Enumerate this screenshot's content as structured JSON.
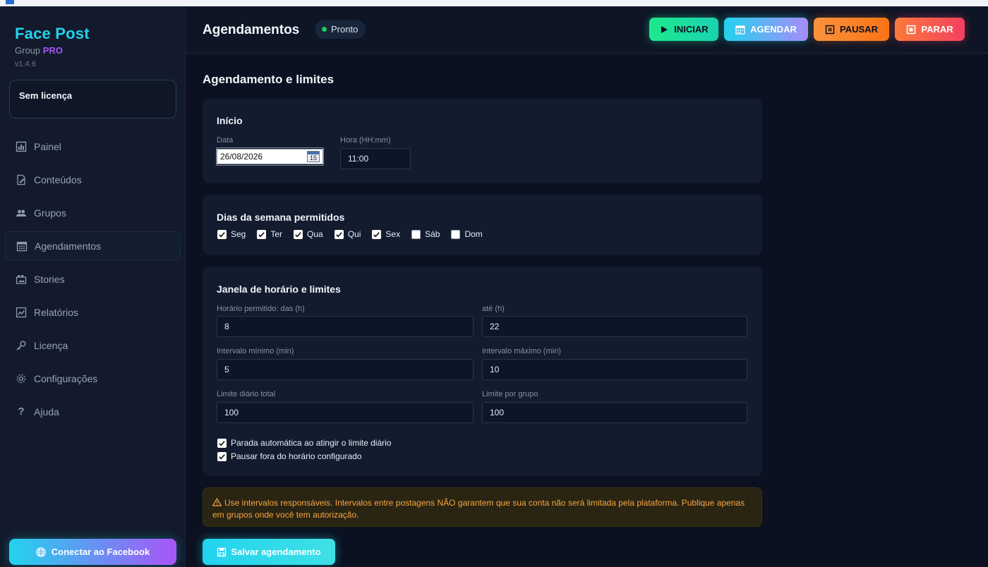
{
  "app": {
    "brand": "Face Post",
    "brand_sub": "Group",
    "brand_tier": "PRO",
    "version": "v1.4.6",
    "license_status": "Sem licença",
    "accent": "#22d3ee",
    "secondary": "#a855f7"
  },
  "sidebar": {
    "items": [
      {
        "label": "Painel",
        "icon": "bar-chart-icon"
      },
      {
        "label": "Conteúdos",
        "icon": "edit-document-icon"
      },
      {
        "label": "Grupos",
        "icon": "users-icon"
      },
      {
        "label": "Agendamentos",
        "icon": "calendar-icon",
        "active": true
      },
      {
        "label": "Stories",
        "icon": "film-icon"
      },
      {
        "label": "Relatórios",
        "icon": "line-chart-icon"
      },
      {
        "label": "Licença",
        "icon": "key-icon"
      },
      {
        "label": "Configurações",
        "icon": "gear-icon"
      },
      {
        "label": "Ajuda",
        "icon": "question-icon"
      }
    ],
    "connect_label": "Conectar ao Facebook"
  },
  "header": {
    "title": "Agendamentos",
    "status": "Pronto",
    "buttons": {
      "start": "INICIAR",
      "schedule": "AGENDAR",
      "pause": "PAUSAR",
      "stop": "PARAR"
    }
  },
  "main": {
    "section_title": "Agendamento e limites",
    "start_card": {
      "title": "Início",
      "date_label": "Data",
      "date_value": "26/08/2026",
      "calendar_day": "15",
      "time_label": "Hora (HH:mm)",
      "time_value": "11:00"
    },
    "days_card": {
      "title": "Dias da semana permitidos",
      "days": [
        {
          "label": "Seg",
          "checked": true
        },
        {
          "label": "Ter",
          "checked": true
        },
        {
          "label": "Qua",
          "checked": true
        },
        {
          "label": "Qui",
          "checked": true
        },
        {
          "label": "Sex",
          "checked": true
        },
        {
          "label": "Sáb",
          "checked": false
        },
        {
          "label": "Dom",
          "checked": false
        }
      ]
    },
    "limits_card": {
      "title": "Janela de horário e limites",
      "from_label": "Horário permitido: das (h)",
      "from_value": "8",
      "to_label": "até (h)",
      "to_value": "22",
      "min_interval_label": "Intervalo mínimo (min)",
      "min_interval_value": "5",
      "max_interval_label": "Intervalo máximo (min)",
      "max_interval_value": "10",
      "daily_limit_label": "Limite diário total",
      "daily_limit_value": "100",
      "group_limit_label": "Limite por grupo",
      "group_limit_value": "100",
      "auto_stop_label": "Parada automática ao atingir o limite diário",
      "auto_stop_checked": true,
      "pause_outside_label": "Pausar fora do horário configurado",
      "pause_outside_checked": true
    },
    "warning": "Use intervalos responsáveis. Intervalos entre postagens NÃO garantem que sua conta não será limitada pela plataforma. Publique apenas em grupos onde você tem autorização.",
    "save_label": "Salvar agendamento"
  }
}
